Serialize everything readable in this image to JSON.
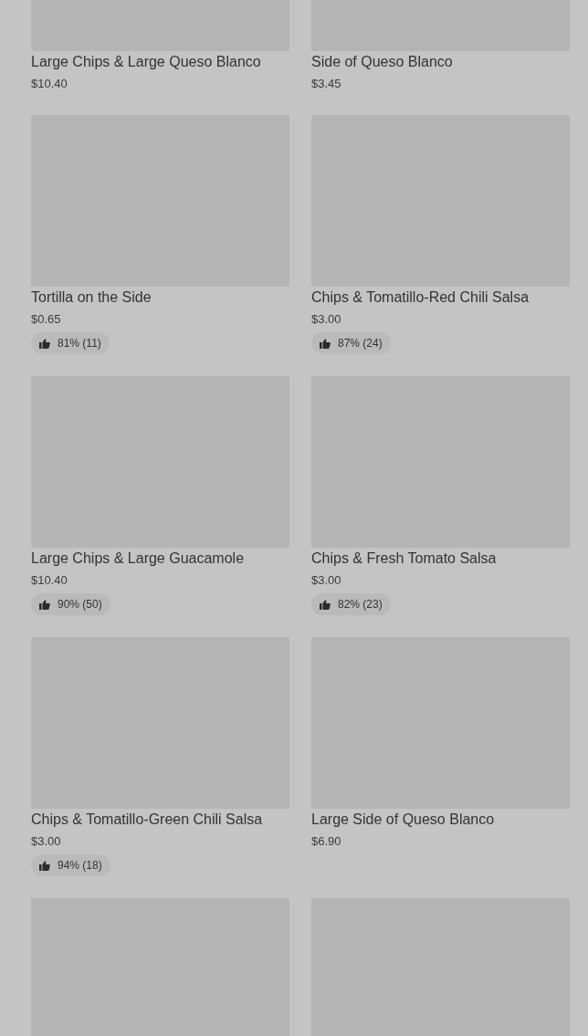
{
  "items": [
    {
      "kind": "dish",
      "name": "Large Chips & Large Queso Blanco",
      "price": "$10.40"
    },
    {
      "kind": "dish",
      "name": "Side of Queso Blanco",
      "price": "$3.45"
    },
    {
      "kind": "dish",
      "name": "Tortilla on the Side",
      "price": "$0.65",
      "rating": "81% (11)"
    },
    {
      "kind": "dish",
      "name": "Chips & Tomatillo-Red Chili Salsa",
      "price": "$3.00",
      "rating": "87% (24)"
    },
    {
      "kind": "dish",
      "name": "Large Chips & Large Guacamole",
      "price": "$10.40",
      "rating": "90% (50)"
    },
    {
      "kind": "dish",
      "name": "Chips & Fresh Tomato Salsa",
      "price": "$3.00",
      "rating": "82% (23)"
    },
    {
      "kind": "dish",
      "name": "Chips & Tomatillo-Green Chili Salsa",
      "price": "$3.00",
      "rating": "94% (18)"
    },
    {
      "kind": "dish",
      "name": "Large Side of Queso Blanco",
      "price": "$6.90"
    },
    {
      "kind": "picture"
    },
    {
      "kind": "picture"
    }
  ]
}
